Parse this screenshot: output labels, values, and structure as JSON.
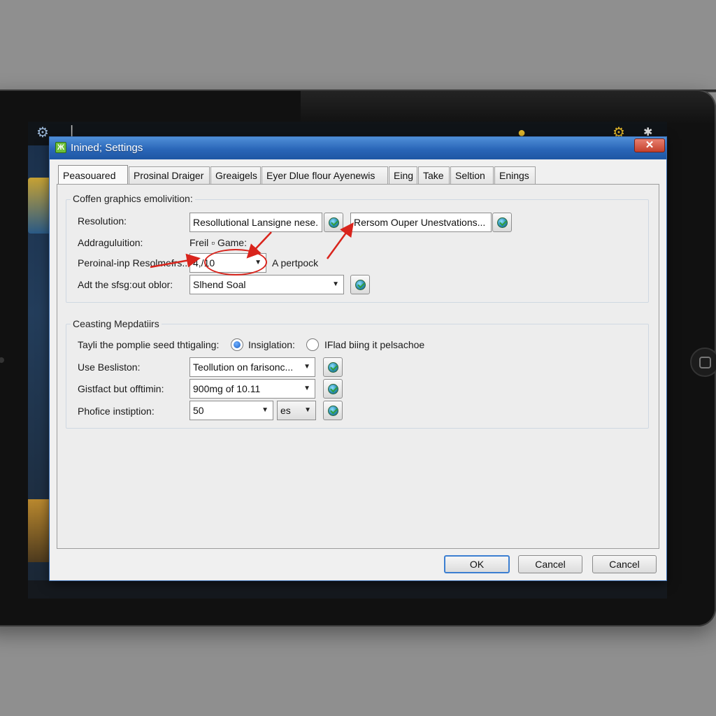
{
  "screen_icons": [
    "user-gear-icon",
    "app-icon",
    "gear-icon",
    "star-icon"
  ],
  "dialog": {
    "title": "Inined; Settings",
    "close_label": "✕",
    "tabs": [
      "Peasouared",
      "Prosinal Draiger",
      "Greaigels",
      "Eyer Dlue flour Ayenewis",
      "Eing",
      "Take",
      "Seltion",
      "Enings"
    ],
    "active_tab": 0
  },
  "group1": {
    "title": "Coffen graphics emolivition:",
    "resolution_label": "Resolution:",
    "resolution_value": "Resollutional Lansigne nese.",
    "resolution_value2": "Rersom Ouper Unestvations...",
    "adjust_label": "Addraguluition:",
    "adjust_text": "Freil  ▫  Game:",
    "personal_label": "Peroinal-inp Resolmefrs..",
    "personal_value": "4,/10",
    "personal_suffix": "A pertpock",
    "adt_label": "Adt the sfsg:out oblor:",
    "adt_value": "Slhend Soal"
  },
  "group2": {
    "title": "Ceasting Mepdatiirs",
    "tayli_label": "Tayli the pomplie seed thtigaling:",
    "radio1_label": "Insiglation:",
    "radio2_label": "IFlad biing it pelsachoe",
    "use_label": "Use Besliston:",
    "use_value": "Teollution on farisonc...",
    "gist_label": "Gistfact but offtimin:",
    "gist_value": "900mg of 10.11",
    "pho_label": "Phofice instiption:",
    "pho_value": "50",
    "pho_unit": "es"
  },
  "buttons": {
    "ok": "OK",
    "cancel1": "Cancel",
    "cancel2": "Cancel"
  },
  "colors": {
    "titlebar": "#2a66b8",
    "annotation": "#d9241c",
    "default_button_border": "#3c7fd1"
  }
}
